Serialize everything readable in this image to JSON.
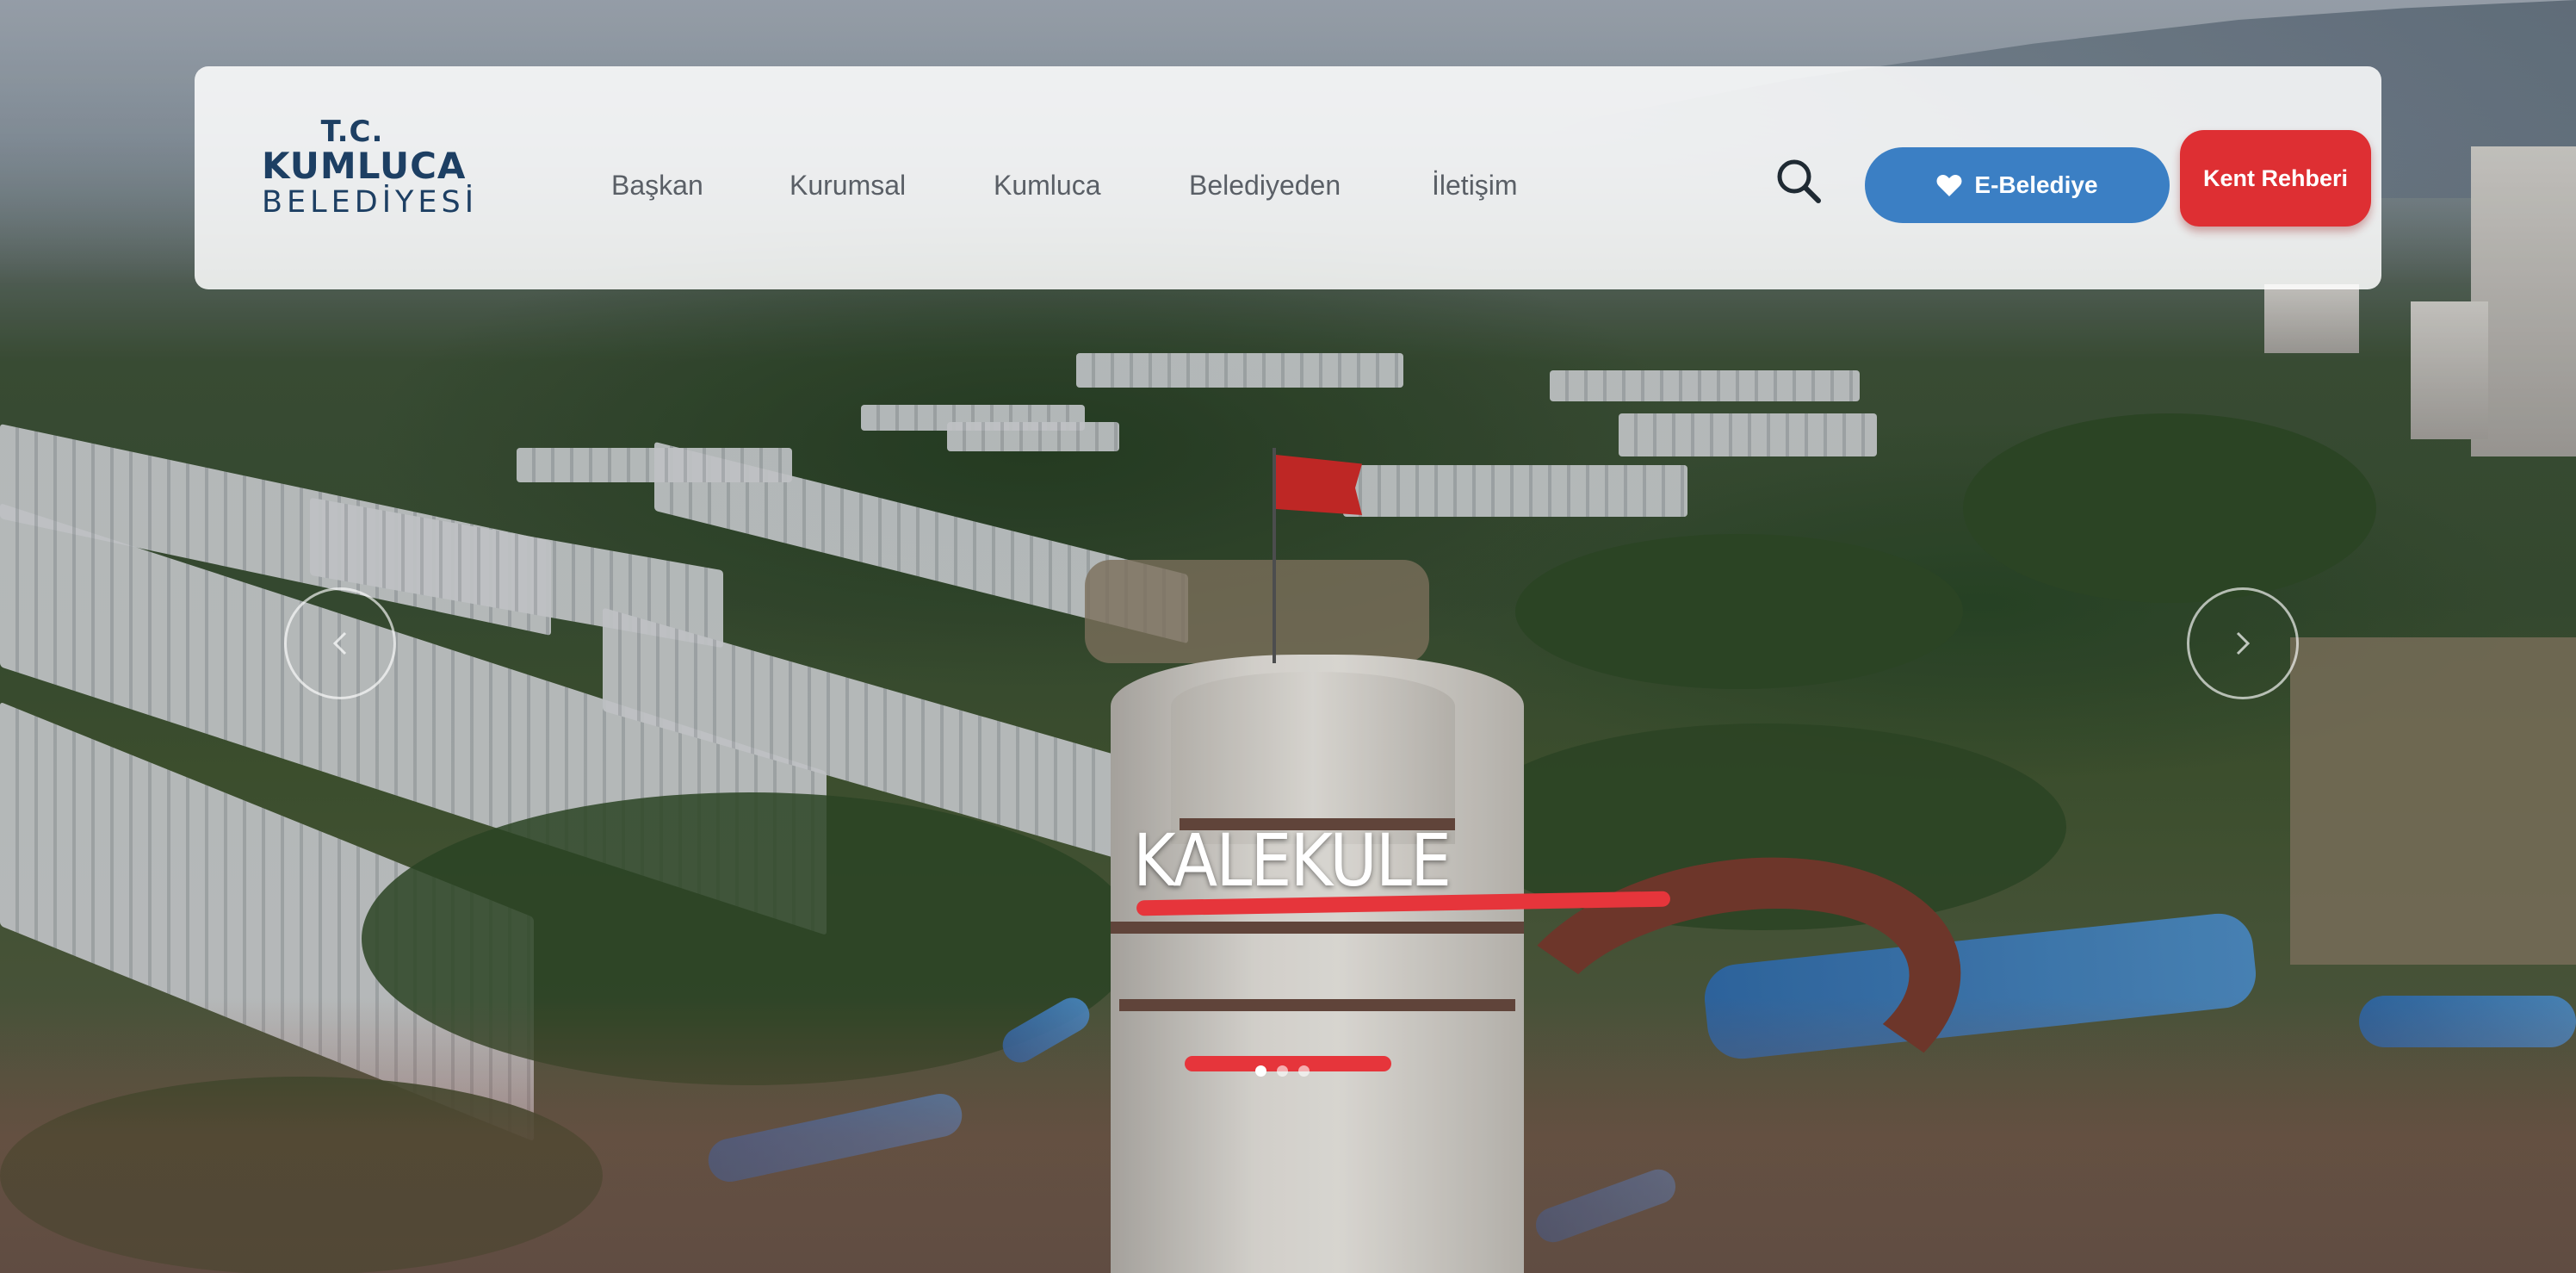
{
  "logo": {
    "line1": "T.C.",
    "line2": "KUMLUCA",
    "line3": "BELEDİYESİ"
  },
  "nav": {
    "items": [
      {
        "label": "Başkan"
      },
      {
        "label": "Kurumsal"
      },
      {
        "label": "Kumluca"
      },
      {
        "label": "Belediyeden"
      },
      {
        "label": "İletişim"
      }
    ]
  },
  "actions": {
    "search_icon": "search-icon",
    "ebelediye_label": "E-Belediye",
    "ebelediye_icon": "heart-icon",
    "kent_rehberi_label": "Kent Rehberi"
  },
  "slider": {
    "title": "KALEKULE",
    "slide_count": 3,
    "active_slide": 1,
    "prev_icon": "chevron-left-icon",
    "next_icon": "chevron-right-icon"
  },
  "colors": {
    "brand_navy": "#1d3f63",
    "primary_blue": "#3b7fc4",
    "accent_red": "#de2f33",
    "nav_text": "#5a5f66"
  }
}
